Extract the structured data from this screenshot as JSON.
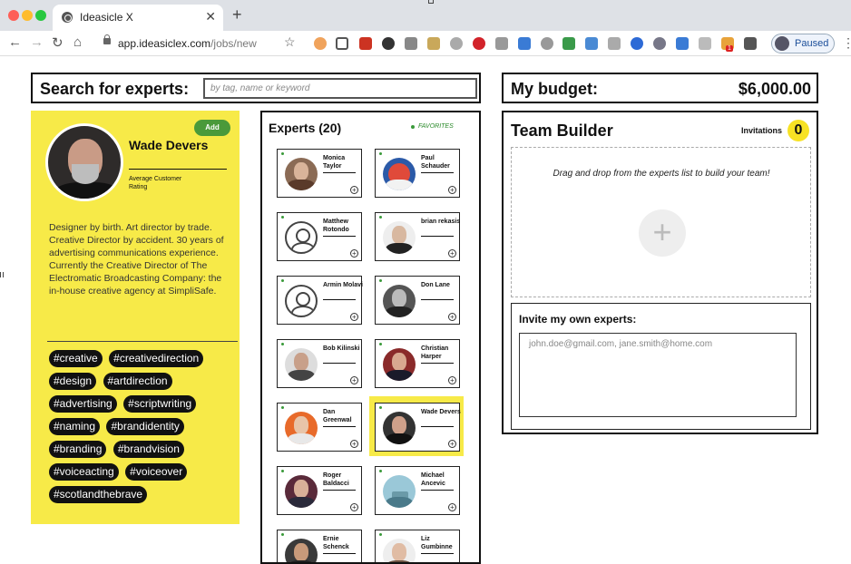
{
  "browser": {
    "tab_title": "Ideasicle X",
    "url_host": "app.ideasiclex.com",
    "url_path": "/jobs/new",
    "profile_status": "Paused",
    "extensions_badge": "1"
  },
  "search": {
    "label": "Search for experts:",
    "placeholder": "by tag, name or keyword"
  },
  "budget": {
    "label": "My budget:",
    "value": "$6,000.00"
  },
  "profile": {
    "name": "Wade Devers",
    "rating_label": "Average Customer Rating",
    "add_label": "Add",
    "bio": "Designer by birth. Art director by trade. Creative Director by accident. 30 years of advertising communications experience. Currently the Creative Director of The Electromatic Broadcasting Company: the in-house creative agency at SimpliSafe.",
    "tags": [
      "#creative",
      "#creativedirection",
      "#design",
      "#artdirection",
      "#advertising",
      "#scriptwriting",
      "#naming",
      "#brandidentity",
      "#branding",
      "#brandvision",
      "#voiceacting",
      "#voiceover",
      "#scotlandthebrave"
    ]
  },
  "experts": {
    "title": "Experts (20)",
    "favorites_label": "FAVORITES",
    "items": [
      {
        "name": "Monica Taylor"
      },
      {
        "name": "Paul Schauder"
      },
      {
        "name": "Matthew Rotondo"
      },
      {
        "name": "brian rekasis"
      },
      {
        "name": "Armin Molavi"
      },
      {
        "name": "Don Lane"
      },
      {
        "name": "Bob Kilinski"
      },
      {
        "name": "Christian Harper"
      },
      {
        "name": "Dan Greenwal"
      },
      {
        "name": "Wade Devers"
      },
      {
        "name": "Roger Baldacci"
      },
      {
        "name": "Michael Ancevic"
      },
      {
        "name": "Ernie Schenck"
      },
      {
        "name": "Liz Gumbinne"
      }
    ]
  },
  "team": {
    "title": "Team Builder",
    "invitations_label": "Invitations",
    "invitations_count": "0",
    "drop_text": "Drag and drop from the experts list to build your team!",
    "invite_label": "Invite my own experts:",
    "invite_placeholder": "john.doe@gmail.com, jane.smith@home.com"
  },
  "colors": {
    "accent_yellow": "#f7ea48",
    "add_green": "#4a9a3a",
    "tag_black": "#111111"
  }
}
